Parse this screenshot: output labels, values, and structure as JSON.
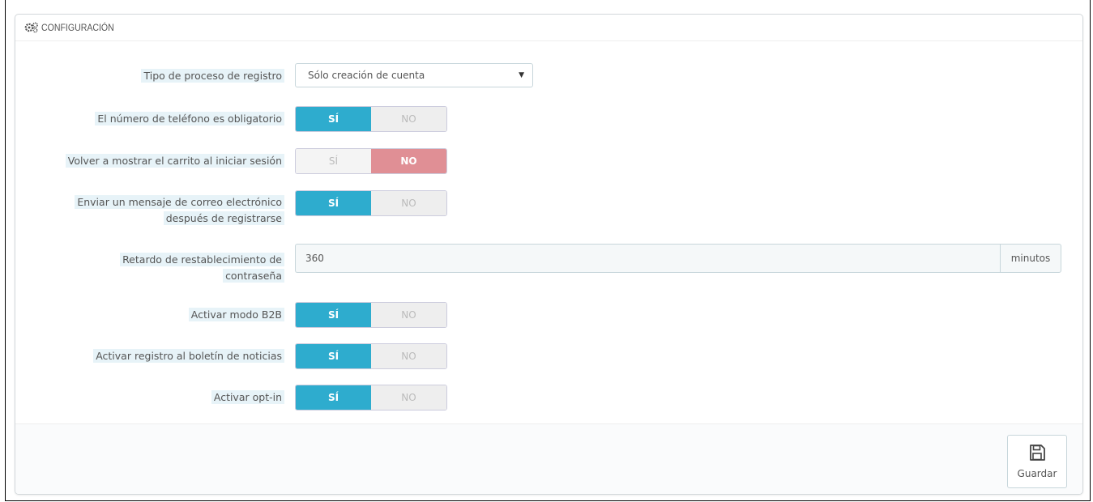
{
  "panel": {
    "title": "CONFIGURACIÓN",
    "title_icon": "gears-icon"
  },
  "fields": {
    "registration_type": {
      "label": "Tipo de proceso de registro",
      "value": "Sólo creación de cuenta"
    },
    "phone_required": {
      "label": "El número de teléfono es obligatorio",
      "yes": "SÍ",
      "no": "NO",
      "selected": "yes"
    },
    "show_cart_login": {
      "label": "Volver a mostrar el carrito al iniciar sesión",
      "yes": "SÍ",
      "no": "NO",
      "selected": "no"
    },
    "send_email": {
      "label_line1": "Enviar un mensaje de correo electrónico",
      "label_line2": "después de registrarse",
      "yes": "SÍ",
      "no": "NO",
      "selected": "yes"
    },
    "password_reset": {
      "label_line1": "Retardo de restablecimiento de",
      "label_line2": "contraseña",
      "value": "360",
      "unit": "minutos"
    },
    "b2b_mode": {
      "label": "Activar modo B2B",
      "yes": "SÍ",
      "no": "NO",
      "selected": "yes"
    },
    "newsletter": {
      "label": "Activar registro al boletín de noticias",
      "yes": "SÍ",
      "no": "NO",
      "selected": "yes"
    },
    "optin": {
      "label": "Activar opt-in",
      "yes": "SÍ",
      "no": "NO",
      "selected": "yes"
    }
  },
  "footer": {
    "save_label": "Guardar",
    "save_icon": "floppy-disk-icon"
  },
  "colors": {
    "switch_yes": "#2eacce",
    "switch_no": "#e08f95",
    "label_highlight": "#e7f3f8"
  }
}
